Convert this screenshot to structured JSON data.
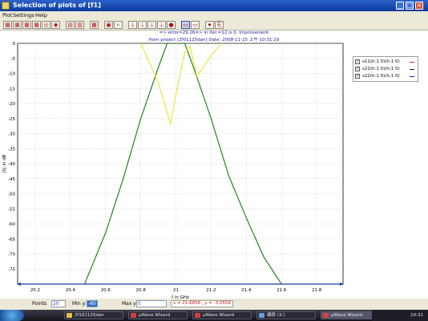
{
  "window": {
    "title": "Selection of plots of [f1]",
    "controls": {
      "minimize": "_",
      "maximize": "□",
      "close": "×"
    }
  },
  "menu": [
    "Plot",
    "Settings",
    "Help"
  ],
  "toolbar": [
    {
      "icon": "plot-s11-icon",
      "glyph": "▦"
    },
    {
      "icon": "plot-s21-icon",
      "glyph": "▦"
    },
    {
      "icon": "plot-s12-icon",
      "glyph": "▦"
    },
    {
      "icon": "plot-s22-icon",
      "glyph": "▦"
    },
    {
      "icon": "smith-chart-icon",
      "glyph": "◎"
    },
    {
      "icon": "polar-chart-icon",
      "glyph": "◉"
    },
    {
      "icon": "multi-plot-icon",
      "glyph": "▤"
    },
    {
      "icon": "table-plot-icon",
      "glyph": "▥"
    },
    {
      "icon": "grid-icon",
      "glyph": "▩"
    },
    {
      "icon": "print-icon",
      "glyph": "▣"
    },
    {
      "icon": "zoom-icon",
      "glyph": "⌕"
    },
    {
      "icon": "axis-left-icon",
      "glyph": "⊥"
    },
    {
      "icon": "axis-right-icon",
      "glyph": "⊥"
    },
    {
      "icon": "axis-both-icon",
      "glyph": "⊥"
    },
    {
      "icon": "axis-fit-icon",
      "glyph": "⊥"
    },
    {
      "icon": "marker-icon",
      "glyph": "●"
    },
    {
      "icon": "window-view-icon",
      "glyph": "▭",
      "selected": true
    },
    {
      "icon": "window-split-icon",
      "glyph": "▭"
    },
    {
      "icon": "record-icon",
      "glyph": "⏺"
    },
    {
      "icon": "export-icon",
      "glyph": "⎘"
    }
  ],
  "info": {
    "line1": "=> error=29.26=> in iter.=12 is 0. Improvement",
    "line2": "from project [2f01125dan]    Date: 2008-11-25 上午 10:31:29"
  },
  "legend": [
    {
      "label": "s11(h:1 0)(h:1 0)",
      "checked": "✓",
      "color": "#e02020"
    },
    {
      "label": "s21(h:1 0)(h:1 0)",
      "checked": "✓",
      "color": "#202020"
    },
    {
      "label": "s22(h:1 0)(h:1 0)",
      "checked": "✓",
      "color": "#2020e0"
    }
  ],
  "bottom": {
    "points_label": "Points",
    "points_value": "20",
    "miny_label": "Min y:",
    "miny_value": "-80",
    "maxy_label": "Max y:",
    "maxy_value": "0",
    "coord_text": "x = 21.6858 , y = -3.0556"
  },
  "taskbar": {
    "items": [
      {
        "label": "2f101125dan",
        "color": "#e8c040"
      },
      {
        "label": "µWave Wizard",
        "color": "#d04040"
      },
      {
        "label": "µWave Wizard",
        "color": "#d04040"
      },
      {
        "label": "编修 (3:)",
        "color": "#60a0e0"
      },
      {
        "label": "µWave Wizard",
        "color": "#d04040",
        "active": true
      }
    ],
    "clock": "10:31"
  },
  "chart_data": {
    "type": "line",
    "xlabel": "f in GHz",
    "ylabel": "|S| in dB",
    "xlim": [
      20.1,
      21.95
    ],
    "ylim": [
      -80,
      0
    ],
    "xticks": [
      "20.2",
      "20.4",
      "20.6",
      "20.8",
      "21",
      "21.2",
      "21.4",
      "21.6",
      "21.8"
    ],
    "yticks": [
      "0",
      "-5",
      "-10",
      "-15",
      "-20",
      "-25",
      "-30",
      "-35",
      "-40",
      "-45",
      "-50",
      "-55",
      "-60",
      "-65",
      "-70",
      "-75"
    ],
    "grid": true,
    "series": [
      {
        "name": "s21(h:1 0)(h:1 0)",
        "color": "#1a8a1a",
        "points": [
          [
            20.48,
            -80
          ],
          [
            20.6,
            -63
          ],
          [
            20.7,
            -45
          ],
          [
            20.8,
            -25
          ],
          [
            20.9,
            -8
          ],
          [
            20.95,
            0
          ],
          [
            21.05,
            0
          ],
          [
            21.1,
            -8
          ],
          [
            21.2,
            -25
          ],
          [
            21.3,
            -44
          ],
          [
            21.4,
            -58
          ],
          [
            21.5,
            -71
          ],
          [
            21.6,
            -80
          ]
        ]
      },
      {
        "name": "s11(h:1 0)(h:1 0)",
        "color": "#f0e640",
        "points": [
          [
            20.8,
            0
          ],
          [
            20.9,
            -13
          ],
          [
            20.97,
            -27
          ],
          [
            21.0,
            -17
          ],
          [
            21.05,
            -3
          ],
          [
            21.08,
            -1
          ],
          [
            21.12,
            -11
          ],
          [
            21.2,
            -4
          ],
          [
            21.26,
            0
          ]
        ]
      }
    ]
  }
}
